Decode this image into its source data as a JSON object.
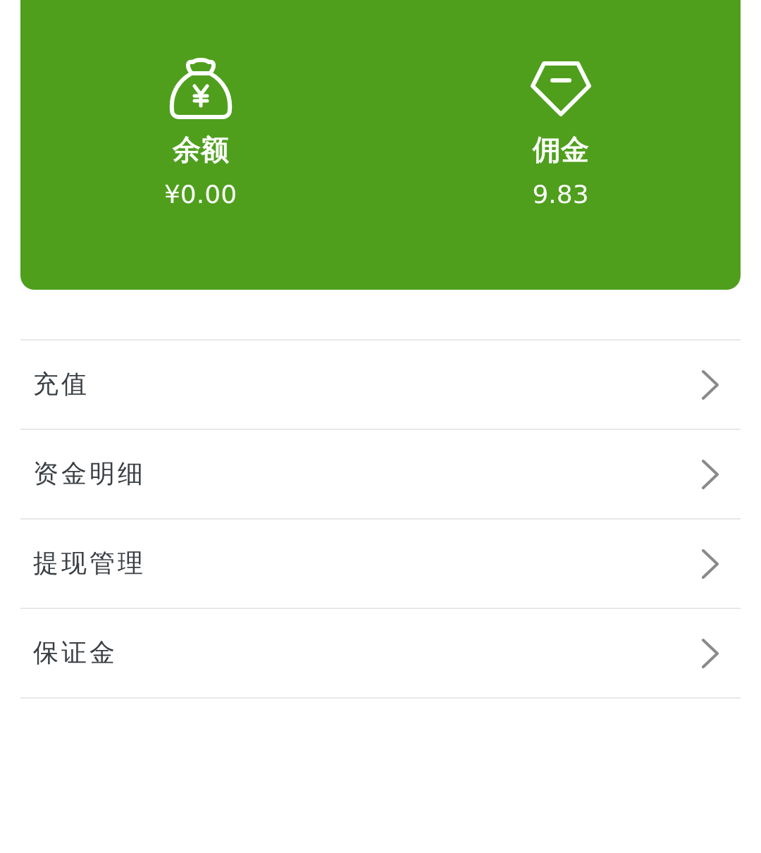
{
  "summary": [
    {
      "kind": "balance",
      "label": "余额",
      "value": "¥0.00"
    },
    {
      "kind": "commission",
      "label": "佣金",
      "value": "9.83"
    }
  ],
  "menu": [
    {
      "label": "充值"
    },
    {
      "label": "资金明细"
    },
    {
      "label": "提现管理"
    },
    {
      "label": "保证金"
    }
  ]
}
